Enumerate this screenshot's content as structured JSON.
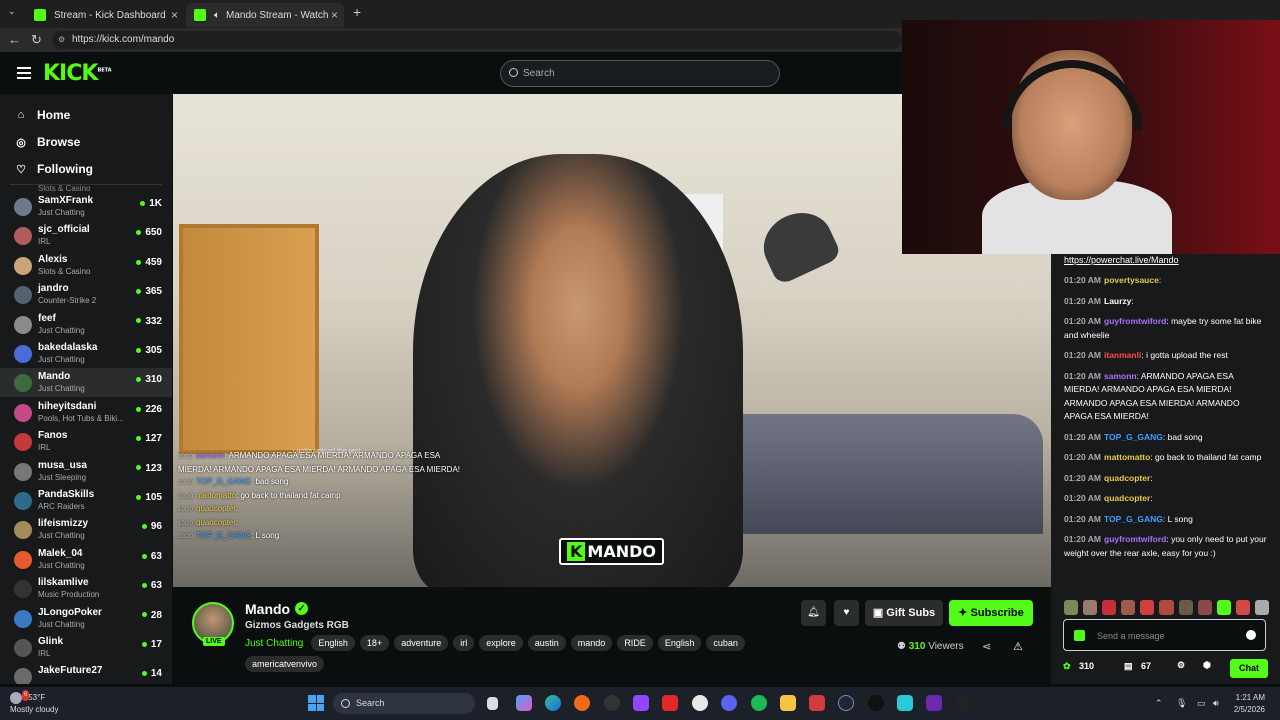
{
  "browser": {
    "tabs": [
      {
        "label": "Stream - Kick Dashboard"
      },
      {
        "label": "Mando Stream - Watch Live o"
      }
    ],
    "url": "https://kick.com/mando"
  },
  "header": {
    "logo": "KICK",
    "logo_badge": "BETA",
    "search_placeholder": "Search"
  },
  "sidebar": {
    "nav": [
      {
        "label": "Home",
        "icon": "home-icon"
      },
      {
        "label": "Browse",
        "icon": "compass-icon"
      },
      {
        "label": "Following",
        "icon": "heart-icon"
      }
    ],
    "partial_top_category": "Slots & Casino",
    "channels": [
      {
        "name": "SamXFrank",
        "category": "Just Chatting",
        "viewers": "1K",
        "color": "#6b7a8a"
      },
      {
        "name": "sjc_official",
        "category": "IRL",
        "viewers": "650",
        "color": "#b25b5b"
      },
      {
        "name": "Alexis",
        "category": "Slots & Casino",
        "viewers": "459",
        "color": "#caa37a"
      },
      {
        "name": "jandro",
        "category": "Counter-Strike 2",
        "viewers": "365",
        "color": "#556070"
      },
      {
        "name": "feef",
        "category": "Just Chatting",
        "viewers": "332",
        "color": "#8a8a8a"
      },
      {
        "name": "bakedalaska",
        "category": "Just Chatting",
        "viewers": "305",
        "color": "#4b6bd9"
      },
      {
        "name": "Mando",
        "category": "Just Chatting",
        "viewers": "310",
        "color": "#3e6b3e"
      },
      {
        "name": "hiheyitsdani",
        "category": "Pools, Hot Tubs & Biki...",
        "viewers": "226",
        "color": "#c44a8a"
      },
      {
        "name": "Fanos",
        "category": "IRL",
        "viewers": "127",
        "color": "#c43a3a"
      },
      {
        "name": "musa_usa",
        "category": "Just Sleeping",
        "viewers": "123",
        "color": "#777777"
      },
      {
        "name": "PandaSkills",
        "category": "ARC Raiders",
        "viewers": "105",
        "color": "#2f6a8a"
      },
      {
        "name": "lifeismizzy",
        "category": "Just Chatting",
        "viewers": "96",
        "color": "#a58a5a"
      },
      {
        "name": "Malek_04",
        "category": "Just Chatting",
        "viewers": "63",
        "color": "#e35b2a"
      },
      {
        "name": "lilskamlive",
        "category": "Music Production",
        "viewers": "63",
        "color": "#333333"
      },
      {
        "name": "JLongoPoker",
        "category": "Just Chatting",
        "viewers": "28",
        "color": "#3a7ac4"
      },
      {
        "name": "Glink",
        "category": "IRL",
        "viewers": "17",
        "color": "#555555"
      },
      {
        "name": "JakeFuture27",
        "category": "",
        "viewers": "14",
        "color": "#6a6a6a"
      }
    ]
  },
  "video": {
    "overlay_partial": "i gotta upload the rest",
    "overlay_chat": [
      {
        "time": "10:20",
        "user": "samonn",
        "text": "ARMANDO APAGA ESA MIERDA! ARMANDO APAGA ESA MIERDA! ARMANDO APAGA ESA MIERDA! ARMANDO APAGA ESA MIERDA!",
        "cls": "u1"
      },
      {
        "time": "10:20",
        "user": "TOP_G_GANG",
        "text": "bad song",
        "cls": "u2"
      },
      {
        "time": "10:20",
        "user": "mattomatto",
        "text": "go back to thailand fat camp",
        "cls": "u3"
      },
      {
        "time": "10:20",
        "user": "quadcopter",
        "text": "",
        "cls": "u3"
      },
      {
        "time": "10:20",
        "user": "quadcopter",
        "text": "",
        "cls": "u3"
      },
      {
        "time": "10:20",
        "user": "TOP_G_GANG",
        "text": "L song",
        "cls": "u2"
      }
    ],
    "watermark_k": "K",
    "watermark_name": "MANDO"
  },
  "stream": {
    "name": "Mando",
    "live": "LIVE",
    "title": "Gizmos Gadgets RGB",
    "category": "Just Chatting",
    "tags": [
      "English",
      "18+",
      "adventure",
      "irl",
      "explore",
      "austin",
      "mando",
      "RIDE",
      "English",
      "cuban",
      "americatvenvivo"
    ],
    "gift_label": "Gift Subs",
    "subscribe_label": "Subscribe",
    "viewers": "310",
    "viewers_label": "Viewers"
  },
  "chat": {
    "link": "https://powerchat.live/Mando",
    "messages": [
      {
        "time": "01:20 AM",
        "user": "povertysauce",
        "color": "#e6c84a",
        "text": ""
      },
      {
        "time": "01:20 AM",
        "user": "Laurzy",
        "color": "#ffffff",
        "text": ""
      },
      {
        "time": "01:20 AM",
        "user": "guyfromtwiford",
        "color": "#a870ff",
        "text": "maybe try some fat bike and wheelie"
      },
      {
        "time": "01:20 AM",
        "user": "itanmanli",
        "color": "#ff4a4a",
        "text": "i gotta upload the rest"
      },
      {
        "time": "01:20 AM",
        "user": "samonn",
        "color": "#a870ff",
        "text": "ARMANDO APAGA ESA MIERDA! ARMANDO APAGA ESA MIERDA! ARMANDO APAGA ESA MIERDA! ARMANDO APAGA ESA MIERDA!"
      },
      {
        "time": "01:20 AM",
        "user": "TOP_G_GANG",
        "color": "#3ea0ff",
        "text": "bad song"
      },
      {
        "time": "01:20 AM",
        "user": "mattomatto",
        "color": "#e6c84a",
        "text": "go back to thailand fat camp"
      },
      {
        "time": "01:20 AM",
        "user": "quadcopter",
        "color": "#e6c84a",
        "text": ""
      },
      {
        "time": "01:20 AM",
        "user": "quadcopter",
        "color": "#e6c84a",
        "text": ""
      },
      {
        "time": "01:20 AM",
        "user": "TOP_G_GANG",
        "color": "#3ea0ff",
        "text": "L song"
      },
      {
        "time": "01:20 AM",
        "user": "guyfromtwiford",
        "color": "#a870ff",
        "text": "you only need to put your weight over the rear axle, easy for you :)"
      }
    ],
    "input_placeholder": "Send a message",
    "kick_points": "310",
    "subs_count": "67",
    "chat_button": "Chat"
  },
  "taskbar": {
    "temperature": "53°F",
    "weather": "Mostly cloudy",
    "weather_badge": "6",
    "search_placeholder": "Search",
    "time": "1:21 AM",
    "date": "2/5/2026"
  }
}
